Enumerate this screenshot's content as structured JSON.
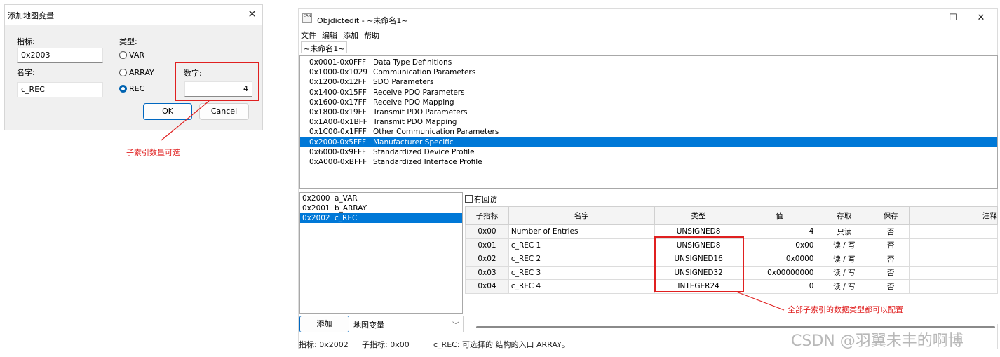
{
  "dialog": {
    "title": "添加地图变量",
    "index_label": "指标:",
    "index_value": "0x2003",
    "name_label": "名字:",
    "name_value": "c_REC",
    "type_label": "类型:",
    "type_options": [
      "VAR",
      "ARRAY",
      "REC"
    ],
    "selected_type": "REC",
    "number_label": "数字:",
    "number_value": "4",
    "ok_label": "OK",
    "cancel_label": "Cancel",
    "annotation": "子索引数量可选"
  },
  "window": {
    "title": "Objdictedit - ~未命名1~",
    "app_icon_text": "CAN",
    "minimize_icon": "—",
    "maximize_icon": "☐",
    "close_icon": "✕",
    "menu": [
      "文件",
      "编辑",
      "添加",
      "帮助"
    ],
    "doc_tab": "~未命名1~",
    "ranges": [
      {
        "id": "0x0001-0x0FFF",
        "name": "Data Type Definitions"
      },
      {
        "id": "0x1000-0x1029",
        "name": "Communication Parameters"
      },
      {
        "id": "0x1200-0x12FF",
        "name": "SDO Parameters"
      },
      {
        "id": "0x1400-0x15FF",
        "name": "Receive PDO Parameters"
      },
      {
        "id": "0x1600-0x17FF",
        "name": "Receive PDO Mapping"
      },
      {
        "id": "0x1800-0x19FF",
        "name": "Transmit PDO Parameters"
      },
      {
        "id": "0x1A00-0x1BFF",
        "name": "Transmit PDO Mapping"
      },
      {
        "id": "0x1C00-0x1FFF",
        "name": "Other Communication Parameters"
      },
      {
        "id": "0x2000-0x5FFF",
        "name": "Manufacturer Specific"
      },
      {
        "id": "0x6000-0x9FFF",
        "name": "Standardized Device Profile"
      },
      {
        "id": "0xA000-0xBFFF",
        "name": "Standardized Interface Profile"
      }
    ],
    "selected_range": 8,
    "objects": [
      {
        "id": "0x2000",
        "name": "a_VAR"
      },
      {
        "id": "0x2001",
        "name": "b_ARRAY"
      },
      {
        "id": "0x2002",
        "name": "c_REC"
      }
    ],
    "selected_object": 2,
    "add_button": "添加",
    "type_select": "地图变量",
    "checkbox_label": "有回访",
    "grid_headers": [
      "子指标",
      "名字",
      "类型",
      "值",
      "存取",
      "保存",
      "注释"
    ],
    "grid_rows": [
      {
        "sub": "0x00",
        "name": "Number of Entries",
        "type": "UNSIGNED8",
        "value": "4",
        "access": "只读",
        "save": "否",
        "comment": ""
      },
      {
        "sub": "0x01",
        "name": "c_REC 1",
        "type": "UNSIGNED8",
        "value": "0x00",
        "access": "读 / 写",
        "save": "否",
        "comment": ""
      },
      {
        "sub": "0x02",
        "name": "c_REC 2",
        "type": "UNSIGNED16",
        "value": "0x0000",
        "access": "读 / 写",
        "save": "否",
        "comment": ""
      },
      {
        "sub": "0x03",
        "name": "c_REC 3",
        "type": "UNSIGNED32",
        "value": "0x00000000",
        "access": "读 / 写",
        "save": "否",
        "comment": ""
      },
      {
        "sub": "0x04",
        "name": "c_REC 4",
        "type": "INTEGER24",
        "value": "0",
        "access": "读 / 写",
        "save": "否",
        "comment": ""
      }
    ],
    "grid_annotation": "全部子索引的数据类型都可以配置",
    "status": {
      "index": "指标: 0x2002",
      "subindex": "子指标: 0x00",
      "message": "c_REC: 可选择的 结构的入口 ARRAY。"
    }
  },
  "watermark": "CSDN @羽翼未丰的啊博",
  "colors": {
    "selection": "#0078d7",
    "annotation": "#e02020",
    "accent": "#0067c0"
  }
}
